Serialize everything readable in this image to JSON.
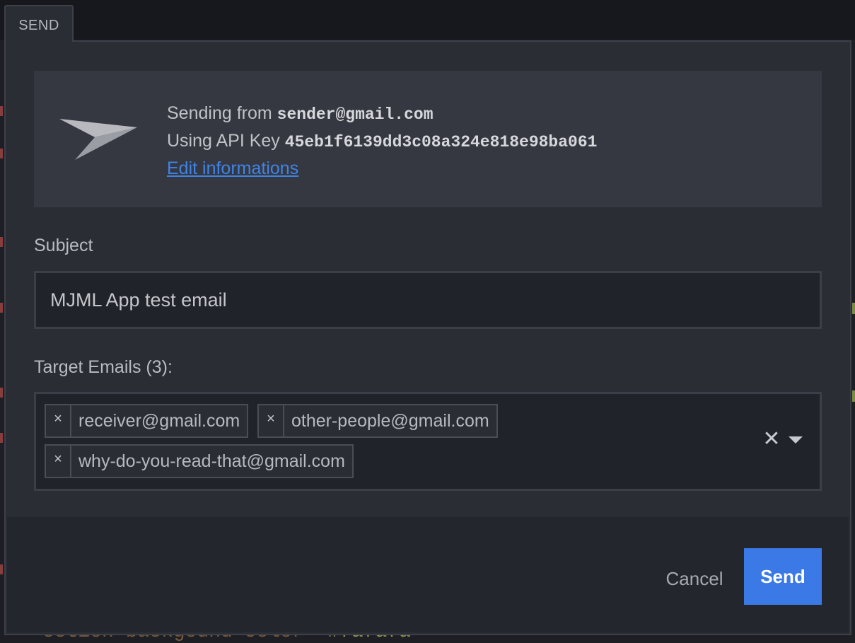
{
  "background_code": {
    "line_prefix": "ection backgound color=",
    "line_value": "#fafafa",
    "line_suffix": ">"
  },
  "tab": {
    "label": "SEND"
  },
  "info": {
    "icon": "paper-plane-icon",
    "sending_from_prefix": "Sending from",
    "sender_email": "sender@gmail.com",
    "api_key_prefix": "Using API Key",
    "api_key": "45eb1f6139dd3c08a324e818e98ba061",
    "edit_link": "Edit informations"
  },
  "subject": {
    "label": "Subject",
    "value": "MJML App test email"
  },
  "targets": {
    "label": "Target Emails (3):",
    "remove_glyph": "×",
    "clear_glyph": "✕",
    "emails": [
      "receiver@gmail.com",
      "other-people@gmail.com",
      "why-do-you-read-that@gmail.com"
    ]
  },
  "actions": {
    "cancel_label": "Cancel",
    "send_label": "Send",
    "send_color": "#3b7ae6"
  }
}
